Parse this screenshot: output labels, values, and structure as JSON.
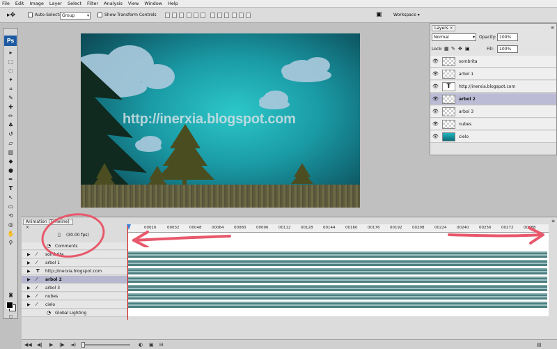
{
  "menu": [
    "File",
    "Edit",
    "Image",
    "Layer",
    "Select",
    "Filter",
    "Analysis",
    "View",
    "Window",
    "Help"
  ],
  "options_bar": {
    "auto_select_label": "Auto-Select:",
    "auto_select_value": "Group",
    "show_transform_label": "Show Transform Controls",
    "workspace_label": "Workspace ▾"
  },
  "toolbox": {
    "logo": "Ps"
  },
  "canvas": {
    "watermark": "http://inerxia.blogspot.com"
  },
  "layers_panel": {
    "tab": "Layers",
    "blend_mode": "Normal",
    "opacity_label": "Opacity:",
    "opacity_value": "100%",
    "lock_label": "Lock:",
    "fill_label": "Fill:",
    "fill_value": "100%",
    "layers": [
      {
        "name": "sombrita",
        "thumb": "checker"
      },
      {
        "name": "arbol 1",
        "thumb": "checker"
      },
      {
        "name": "http://inerxia.blogspot.com",
        "thumb": "text"
      },
      {
        "name": "arbol 2",
        "thumb": "checker",
        "selected": true
      },
      {
        "name": "arbol 3",
        "thumb": "checker"
      },
      {
        "name": "nubes",
        "thumb": "checker"
      },
      {
        "name": "cielo",
        "thumb": "sky"
      }
    ]
  },
  "timeline": {
    "tab": "Animation (Timeline)",
    "fps": "(30.00 fps)",
    "ruler": [
      "00016",
      "00032",
      "00048",
      "00064",
      "00080",
      "00096",
      "00112",
      "00128",
      "00144",
      "00160",
      "00176",
      "00192",
      "00208",
      "00224",
      "00240",
      "00256",
      "00272",
      "00288"
    ],
    "comments_label": "Comments",
    "global_lighting_label": "Global Lighting",
    "layers": [
      "sombrita",
      "arbol 1",
      "http://inerxia.blogspot.com",
      "arbol 2",
      "arbol 3",
      "nubes",
      "cielo"
    ]
  },
  "colors": {
    "annotation": "#e8586b",
    "accent": "#1d5aa3",
    "selected": "#bbbbd6"
  }
}
